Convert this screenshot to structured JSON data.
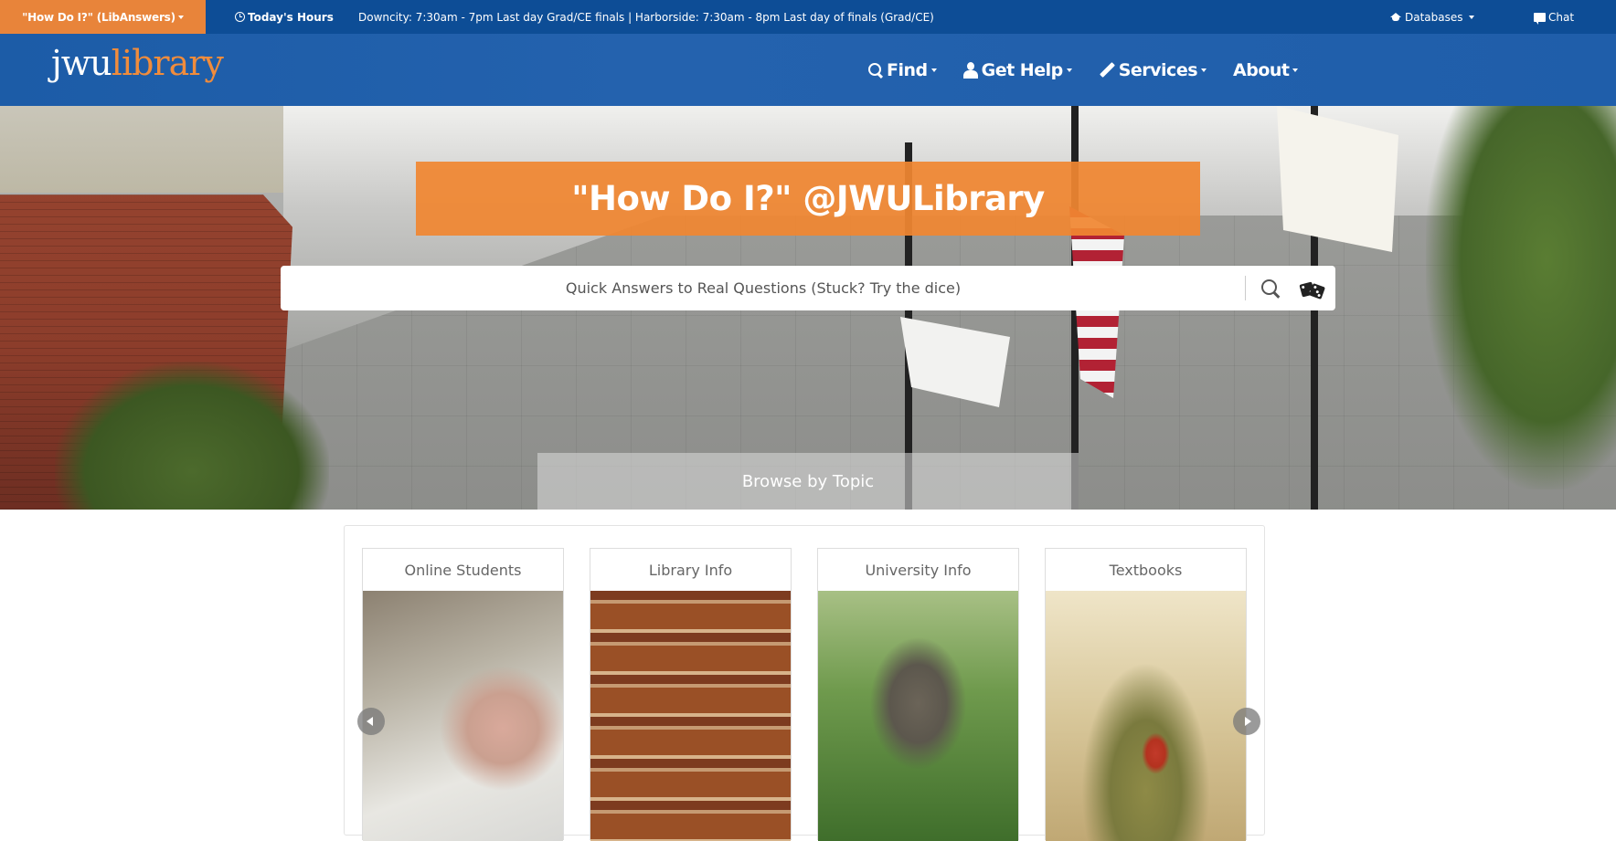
{
  "topbar": {
    "libanswers_label": "\"How Do I?\" (LibAnswers)",
    "hours_label": "Today's Hours",
    "hours_text": "Downcity: 7:30am - 7pm Last day Grad/CE finals | Harborside: 7:30am - 8pm Last day of finals (Grad/CE)",
    "databases_label": "Databases",
    "chat_label": "Chat"
  },
  "logo": {
    "part1": "jwu",
    "part2": "library"
  },
  "nav": [
    {
      "label": "Find",
      "icon": "search-icon"
    },
    {
      "label": "Get Help",
      "icon": "user-icon"
    },
    {
      "label": "Services",
      "icon": "pencil-icon"
    },
    {
      "label": "About"
    }
  ],
  "hero": {
    "title": "\"How Do I?\" @JWULibrary",
    "search_placeholder": "Quick Answers to Real Questions (Stuck? Try the dice)",
    "browse_label": "Browse by Topic"
  },
  "topics": [
    {
      "label": "Online Students"
    },
    {
      "label": "Library Info"
    },
    {
      "label": "University Info"
    },
    {
      "label": "Textbooks"
    }
  ],
  "colors": {
    "brand_blue": "#0d4d96",
    "nav_blue": "#1f5eaa",
    "accent_orange": "#e8843a"
  }
}
